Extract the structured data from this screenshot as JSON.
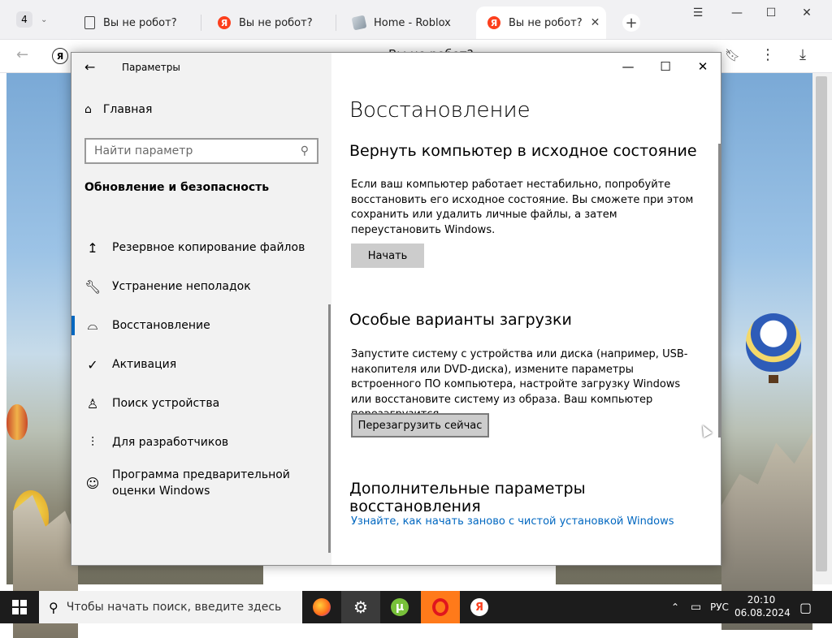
{
  "browser": {
    "tab_count": "4",
    "tabs": [
      {
        "label": "Вы не робот?",
        "favicon": "doc-icon"
      },
      {
        "label": "Вы не робот?",
        "favicon": "yandex-icon"
      },
      {
        "label": "Home - Roblox",
        "favicon": "roblox-icon"
      },
      {
        "label": "Вы не робот?",
        "favicon": "yandex-icon",
        "close": "✕"
      }
    ],
    "yandex_letter": "Я",
    "address_text": "Вы не робот?",
    "window_controls": {
      "menu": "☰",
      "minimize": "—",
      "maximize": "☐",
      "close": "✕"
    }
  },
  "settings": {
    "app_title": "Параметры",
    "nav": {
      "home": "Главная",
      "search_placeholder": "Найти параметр",
      "section": "Обновление и безопасность",
      "items": [
        {
          "label": "Резервное копирование файлов",
          "icon": "backup-arrow-icon"
        },
        {
          "label": "Устранение неполадок",
          "icon": "wrench-icon"
        },
        {
          "label": "Восстановление",
          "icon": "recovery-icon",
          "selected": true
        },
        {
          "label": "Активация",
          "icon": "check-circle-icon"
        },
        {
          "label": "Поиск устройства",
          "icon": "person-pin-icon"
        },
        {
          "label": "Для разработчиков",
          "icon": "developer-icon"
        },
        {
          "label": "Программа предварительной оценки Windows",
          "icon": "insider-cat-icon"
        }
      ]
    },
    "content": {
      "page_title": "Восстановление",
      "reset_heading": "Вернуть компьютер в исходное состояние",
      "reset_text": "Если ваш компьютер работает нестабильно, попробуйте восстановить его исходное состояние. Вы сможете при этом сохранить или удалить личные файлы, а затем переустановить Windows.",
      "reset_button": "Начать",
      "boot_heading": "Особые варианты загрузки",
      "boot_text": "Запустите систему с устройства или диска (например, USB-накопителя или DVD-диска), измените параметры встроенного ПО компьютера, настройте загрузку Windows или восстановите систему из образа. Ваш компьютер перезагрузится.",
      "boot_button": "Перезагрузить сейчас",
      "more_heading": "Дополнительные параметры восстановления",
      "more_link": "Узнайте, как начать заново с чистой установкой Windows"
    }
  },
  "taskbar": {
    "search_placeholder": "Чтобы начать поиск, введите здесь",
    "apps": [
      "firefox-icon",
      "settings-gear-icon",
      "utorrent-icon",
      "opera-icon",
      "yandex-browser-icon"
    ],
    "utorrent_letter": "µ",
    "yandex_letter": "Я",
    "language": "РУС",
    "time": "20:10",
    "date": "06.08.2024"
  },
  "colors": {
    "accent": "#0067c0",
    "nav_bg": "#f2f2f2",
    "taskbar": "#1c1c1c",
    "yandex_red": "#fc3f1d"
  }
}
